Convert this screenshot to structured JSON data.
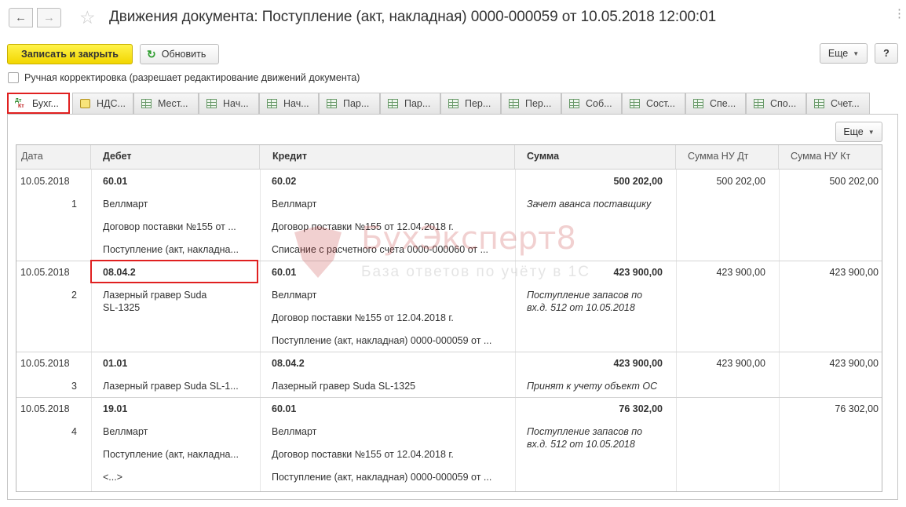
{
  "window": {
    "title": "Движения документа: Поступление (акт, накладная) 0000-000059 от 10.05.2018 12:00:01",
    "back_icon": "arrow-left-icon",
    "forward_icon": "arrow-right-icon",
    "favorite_icon": "star-icon",
    "menu_icon": "more-vertical-icon"
  },
  "toolbar": {
    "save_close_label": "Записать и закрыть",
    "refresh_label": "Обновить",
    "more_label": "Еще",
    "help_label": "?"
  },
  "manual_correction": {
    "label": "Ручная корректировка (разрешает редактирование движений документа)",
    "checked": false
  },
  "tabs": [
    {
      "label": "Бухг...",
      "icon": "dt-kt-icon",
      "active": true
    },
    {
      "label": "НДС...",
      "icon": "vat-icon",
      "active": false
    },
    {
      "label": "Мест...",
      "icon": "register-table-icon",
      "active": false
    },
    {
      "label": "Нач...",
      "icon": "register-table-icon",
      "active": false
    },
    {
      "label": "Нач...",
      "icon": "register-table-icon",
      "active": false
    },
    {
      "label": "Пар...",
      "icon": "register-table-icon",
      "active": false
    },
    {
      "label": "Пар...",
      "icon": "register-table-icon",
      "active": false
    },
    {
      "label": "Пер...",
      "icon": "register-table-icon",
      "active": false
    },
    {
      "label": "Пер...",
      "icon": "register-table-icon",
      "active": false
    },
    {
      "label": "Соб...",
      "icon": "register-table-icon",
      "active": false
    },
    {
      "label": "Сост...",
      "icon": "register-table-icon",
      "active": false
    },
    {
      "label": "Спе...",
      "icon": "register-table-icon",
      "active": false
    },
    {
      "label": "Спо...",
      "icon": "register-table-icon",
      "active": false
    },
    {
      "label": "Счет...",
      "icon": "register-table-icon",
      "active": false
    }
  ],
  "panel": {
    "more_label": "Еще"
  },
  "table": {
    "columns": [
      "Дата",
      "Дебет",
      "Кредит",
      "Сумма",
      "Сумма НУ Дт",
      "Сумма НУ Кт"
    ],
    "records": [
      {
        "date": "10.05.2018",
        "num": "1",
        "debit": [
          "60.01",
          "Веллмарт",
          "Договор поставки №155 от ...",
          "Поступление (акт, накладна..."
        ],
        "credit": [
          "60.02",
          "Веллмарт",
          "Договор поставки №155 от 12.04.2018 г.",
          "Списание с расчетного счета 0000-000060 от ..."
        ],
        "sum": "500 202,00",
        "content": "Зачет аванса поставщику",
        "nu_dt": "500 202,00",
        "nu_kt": "500 202,00"
      },
      {
        "date": "10.05.2018",
        "num": "2",
        "debit": [
          "08.04.2",
          "Лазерный гравер Suda SL-1325",
          "",
          ""
        ],
        "credit": [
          "60.01",
          "Веллмарт",
          "Договор поставки №155 от 12.04.2018 г.",
          "Поступление (акт, накладная) 0000-000059 от ..."
        ],
        "sum": "423 900,00",
        "content": "Поступление запасов по вх.д. 512 от 10.05.2018",
        "nu_dt": "423 900,00",
        "nu_kt": "423 900,00"
      },
      {
        "date": "10.05.2018",
        "num": "3",
        "debit": [
          "01.01",
          "Лазерный гравер Suda SL-1...",
          "",
          ""
        ],
        "credit": [
          "08.04.2",
          "Лазерный гравер Suda SL-1325",
          "",
          ""
        ],
        "sum": "423 900,00",
        "content": "Принят к учету объект ОС",
        "nu_dt": "423 900,00",
        "nu_kt": "423 900,00"
      },
      {
        "date": "10.05.2018",
        "num": "4",
        "debit": [
          "19.01",
          "Веллмарт",
          "Поступление (акт, накладна...",
          "<...>"
        ],
        "credit": [
          "60.01",
          "Веллмарт",
          "Договор поставки №155 от 12.04.2018 г.",
          "Поступление (акт, накладная) 0000-000059 от ..."
        ],
        "sum": "76 302,00",
        "content": "Поступление запасов по вх.д. 512 от 10.05.2018",
        "nu_dt": "",
        "nu_kt": "76 302,00"
      }
    ]
  },
  "watermark": {
    "line1": "БухЭксперт8",
    "line2": "База ответов по учёту в 1С"
  }
}
